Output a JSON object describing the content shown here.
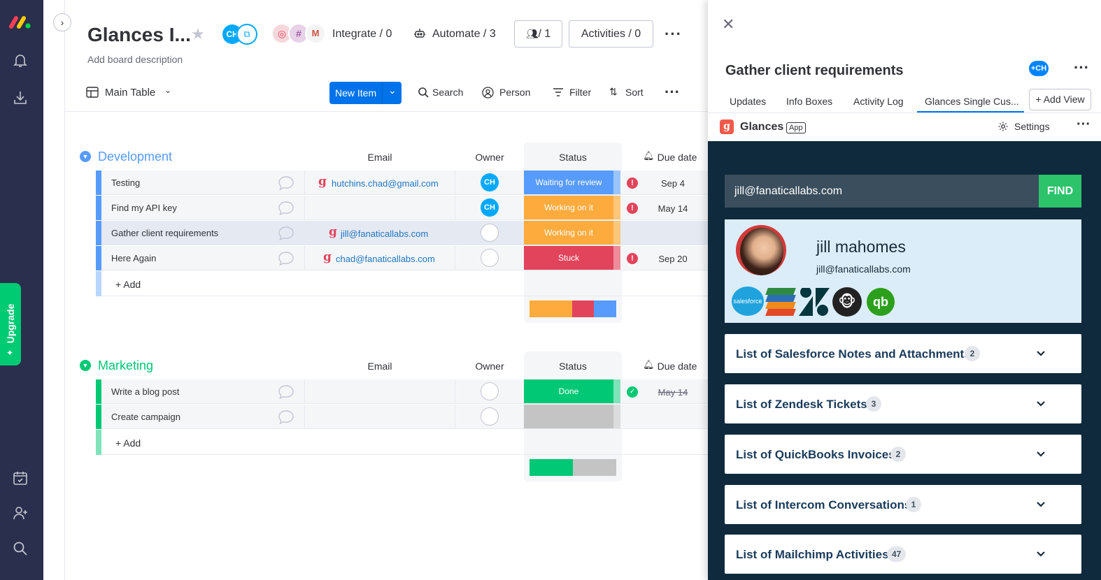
{
  "board": {
    "title": "Glances I...",
    "description": "Add board description",
    "member_initials": "CH",
    "integrate": "Integrate / 0",
    "automate": "Automate / 3",
    "members_count": "/ 1",
    "activities": "Activities / 0",
    "view_name": "Main Table",
    "new_item": "New Item",
    "search": "Search",
    "person": "Person",
    "filter": "Filter",
    "sort": "Sort"
  },
  "sidebar": {
    "upgrade": "Upgrade"
  },
  "columns": {
    "email": "Email",
    "owner": "Owner",
    "status": "Status",
    "due": "Due date"
  },
  "groups": [
    {
      "title": "Development",
      "color": "#579bfc",
      "rows": [
        {
          "name": "Testing",
          "email": "hutchins.chad@gmail.com",
          "owner": "CH",
          "status": "Waiting for review",
          "status_color": "#579bfc",
          "due": "Sep 4"
        },
        {
          "name": "Find my API key",
          "email": "",
          "owner": "CH",
          "status": "Working on it",
          "status_color": "#fdab3d",
          "due": "May 14"
        },
        {
          "name": "Gather client requirements",
          "email": "jill@fanaticallabs.com",
          "owner": "",
          "status": "Working on it",
          "status_color": "#fdab3d",
          "due": ""
        },
        {
          "name": "Here Again",
          "email": "chad@fanaticallabs.com",
          "owner": "",
          "status": "Stuck",
          "status_color": "#e2445c",
          "due": "Sep 20"
        }
      ],
      "add": "+ Add"
    },
    {
      "title": "Marketing",
      "color": "#00c875",
      "rows": [
        {
          "name": "Write a blog post",
          "email": "",
          "owner": "",
          "status": "Done",
          "status_color": "#00c875",
          "due": "May 14"
        },
        {
          "name": "Create campaign",
          "email": "",
          "owner": "",
          "status": "",
          "status_color": "#c4c4c4",
          "due": ""
        }
      ],
      "add": "+ Add"
    }
  ],
  "panel": {
    "title": "Gather client requirements",
    "owner_initials": "CH",
    "tabs": [
      "Updates",
      "Info Boxes",
      "Activity Log",
      "Glances Single Cus..."
    ],
    "add_view": "+ Add View",
    "app_name": "Glances",
    "app_badge": "App",
    "settings": "Settings",
    "search_value": "jill@fanaticallabs.com",
    "find": "FIND",
    "contact_name": "jill mahomes",
    "contact_email": "jill@fanaticallabs.com",
    "integrations": [
      "salesforce",
      "stack-app",
      "zendesk",
      "mailchimp",
      "quickbooks"
    ],
    "sections": [
      {
        "title": "List of Salesforce Notes and Attachments",
        "count": "2"
      },
      {
        "title": "List of Zendesk Tickets",
        "count": "3"
      },
      {
        "title": "List of QuickBooks Invoices",
        "count": "2"
      },
      {
        "title": "List of Intercom Conversations",
        "count": "1"
      },
      {
        "title": "List of Mailchimp Activities",
        "count": "47"
      }
    ]
  }
}
